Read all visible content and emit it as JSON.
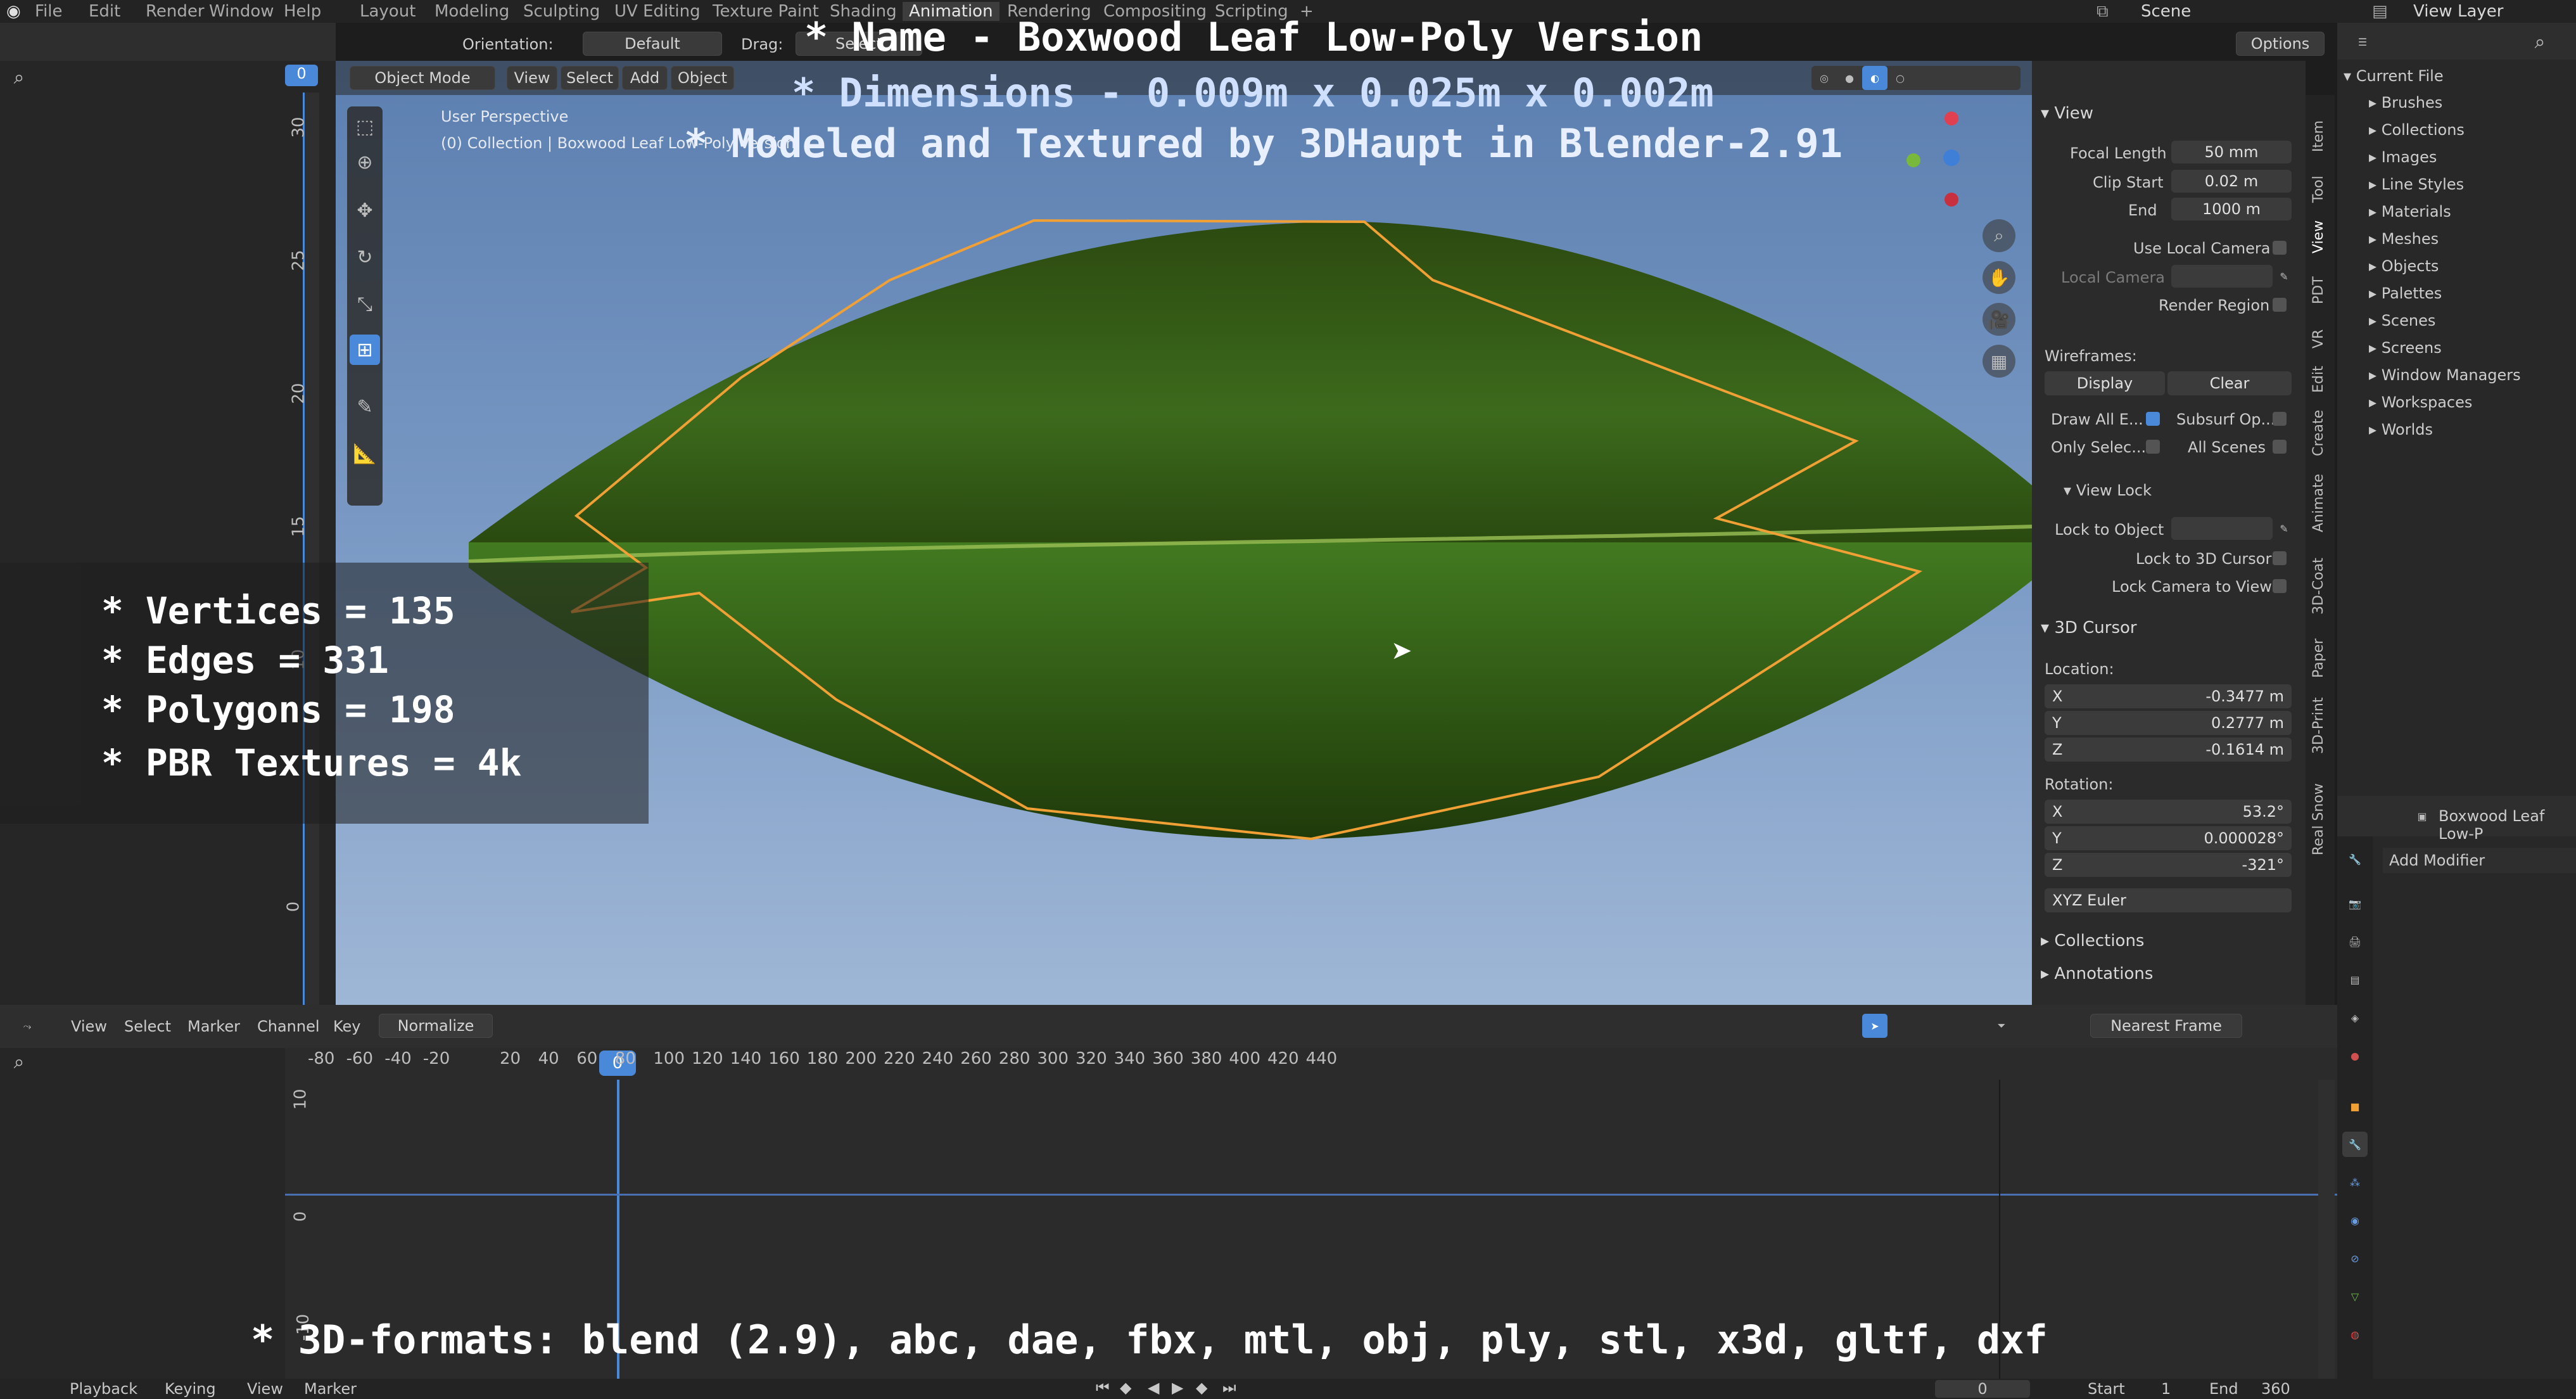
{
  "topbar": {
    "menus": [
      "File",
      "Edit",
      "Render",
      "Window",
      "Help"
    ],
    "workspaces": [
      "Layout",
      "Modeling",
      "Sculpting",
      "UV Editing",
      "Texture Paint",
      "Shading",
      "Animation",
      "Rendering",
      "Compositing",
      "Scripting"
    ],
    "active_workspace": "Animation",
    "scene": "Scene",
    "view_layer": "View Layer"
  },
  "left_panel": {
    "frame_value": "0",
    "ruler": [
      "30",
      "25",
      "20",
      "15",
      "10",
      "0"
    ]
  },
  "viewport_header": {
    "orientation_label": "Orientation:",
    "orientation_value": "Default",
    "drag_label": "Drag:",
    "drag_value": "Select",
    "mode": "Object Mode",
    "menus": [
      "View",
      "Select",
      "Add",
      "Object"
    ],
    "options": "Options"
  },
  "viewport_info": {
    "perspective": "User Perspective",
    "collection": "(0) Collection | Boxwood Leaf Low-Poly Version"
  },
  "overlay": {
    "name": "* Name - Boxwood Leaf Low-Poly Version",
    "dimensions": "* Dimensions -  0.009m x 0.025m x 0.002m",
    "modeled": "* Modeled and Textured by 3DHaupt in Blender-2.91",
    "vertices": "* Vertices = 135",
    "edges": "* Edges = 331",
    "polygons": "* Polygons = 198",
    "textures": "* PBR Textures = 4k",
    "formats": "* 3D-formats: blend (2.9), abc, dae, fbx, mtl, obj, ply, stl, x3d, gltf, dxf"
  },
  "npanel": {
    "view_header": "View",
    "focal_length_label": "Focal Length",
    "focal_length": "50 mm",
    "clip_start_label": "Clip Start",
    "clip_start": "0.02 m",
    "end_label": "End",
    "end": "1000 m",
    "use_local_camera": "Use Local Camera",
    "local_camera": "Local Camera",
    "render_region": "Render Region",
    "wireframes": "Wireframes:",
    "display": "Display",
    "clear": "Clear",
    "draw_all": "Draw All E...",
    "subsurf": "Subsurf Op...",
    "only_selec": "Only Selec...",
    "all_scenes": "All Scenes",
    "view_lock": "View Lock",
    "lock_to_object": "Lock to Object",
    "lock_3d_cursor": "Lock to 3D Cursor",
    "lock_camera": "Lock Camera to View",
    "cursor_header": "3D Cursor",
    "location": "Location:",
    "loc_x": "-0.3477 m",
    "loc_y": "0.2777 m",
    "loc_z": "-0.1614 m",
    "rotation": "Rotation:",
    "rot_x": "53.2°",
    "rot_y": "0.000028°",
    "rot_z": "-321°",
    "euler": "XYZ Euler",
    "collections": "Collections",
    "annotations": "Annotations",
    "axis_x": "X",
    "axis_y": "Y",
    "axis_z": "Z",
    "tabs": [
      "Item",
      "Tool",
      "View",
      "PDT",
      "VR",
      "Edit",
      "Create",
      "Animate",
      "3D-Coat",
      "Paper",
      "3D-Print",
      "Real Snow"
    ]
  },
  "outliner": {
    "root": "Current File",
    "items": [
      "Brushes",
      "Collections",
      "Images",
      "Line Styles",
      "Materials",
      "Meshes",
      "Objects",
      "Palettes",
      "Scenes",
      "Screens",
      "Window Managers",
      "Workspaces",
      "Worlds"
    ]
  },
  "properties": {
    "object_name": "Boxwood Leaf Low-P",
    "add_modifier": "Add Modifier"
  },
  "timeline_header": {
    "menus": [
      "View",
      "Select",
      "Marker",
      "Channel",
      "Key"
    ],
    "normalize": "Normalize",
    "snap": "Nearest Frame"
  },
  "timeline": {
    "frame_ticks": [
      "-80",
      "-60",
      "-40",
      "-20",
      "0",
      "20",
      "40",
      "60",
      "80",
      "100",
      "120",
      "140",
      "160",
      "180",
      "200",
      "220",
      "240",
      "260",
      "280",
      "300",
      "320",
      "340",
      "360",
      "380",
      "400",
      "420",
      "440"
    ],
    "current_frame": "0",
    "value_ticks": [
      "10",
      "0",
      "-10"
    ]
  },
  "statusbar": {
    "playback": "Playback",
    "keying": "Keying",
    "view": "View",
    "marker": "Marker",
    "frame": "0",
    "start_label": "Start",
    "start": "1",
    "end_label": "End",
    "end": "360"
  },
  "colors": {
    "accent": "#4a88d9",
    "selection_outline": "#f0a035",
    "leaf": "#2f5a16",
    "sky": "#7d9cc6"
  }
}
